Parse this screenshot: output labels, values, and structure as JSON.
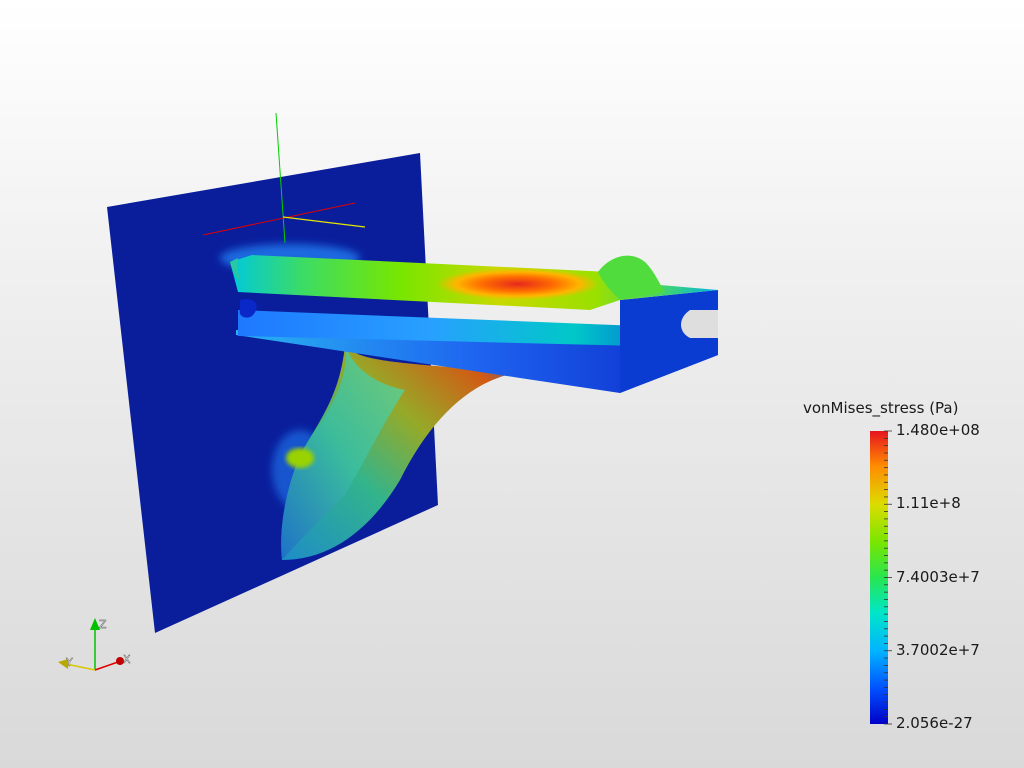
{
  "legend": {
    "title": "vonMises_stress (Pa)",
    "ticks": [
      {
        "label": "1.480e+08",
        "value": 148000000
      },
      {
        "label": "1.11e+8",
        "value": 111000000
      },
      {
        "label": "7.4003e+7",
        "value": 74003000
      },
      {
        "label": "3.7002e+7",
        "value": 37002000
      },
      {
        "label": "2.056e-27",
        "value": 2.056e-27
      }
    ],
    "colormap": [
      "#0000c8",
      "#0050ff",
      "#00b4ff",
      "#00e6c8",
      "#28e650",
      "#78e600",
      "#dcdc00",
      "#ffb400",
      "#ff6400",
      "#e6141e"
    ]
  },
  "orientation_axes": {
    "x": {
      "label": "X",
      "color": "#e00000"
    },
    "y": {
      "label": "Y",
      "color": "#d8c800"
    },
    "z": {
      "label": "Z",
      "color": "#00c000"
    }
  },
  "scene_axes_colors": {
    "x": "#e00000",
    "y": "#e6e600",
    "z": "#00d000"
  }
}
